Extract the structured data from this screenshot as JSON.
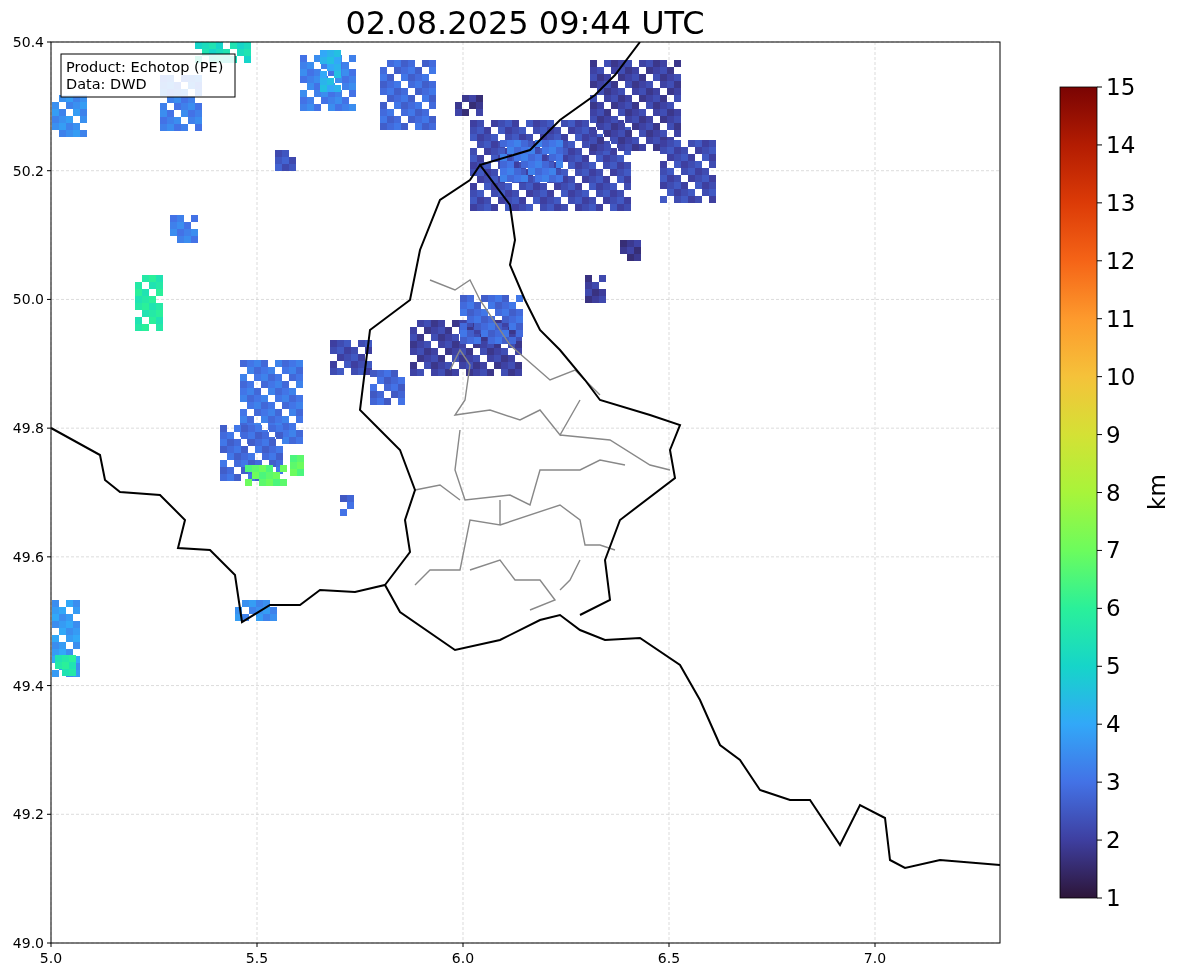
{
  "title": "02.08.2025 09:44 UTC",
  "annotation": [
    "Product: Echotop (PE)",
    "Data: DWD"
  ],
  "map": {
    "x_ticks": [
      "5.0",
      "5.5",
      "6.0",
      "6.5",
      "7.0"
    ],
    "y_ticks": [
      "50.4",
      "50.2",
      "50.0",
      "49.8",
      "49.6",
      "49.4",
      "49.2",
      "49.0"
    ]
  },
  "colorbar": {
    "label": "km",
    "ticks": [
      "15",
      "14",
      "13",
      "12",
      "11",
      "10",
      "9",
      "8",
      "7",
      "6",
      "5",
      "4",
      "3",
      "2",
      "1"
    ]
  }
}
